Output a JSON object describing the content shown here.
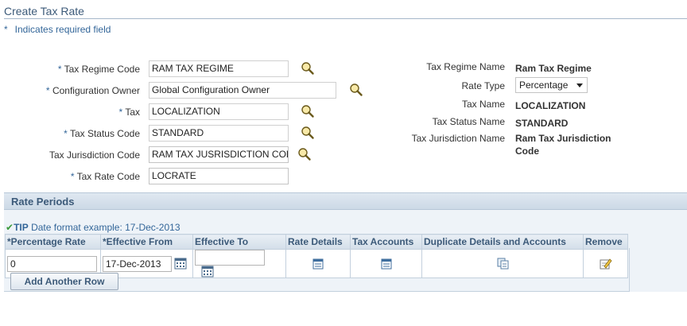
{
  "page": {
    "title": "Create Tax Rate",
    "required_note_star": "*",
    "required_note": "Indicates required field"
  },
  "form": {
    "tax_regime_code": {
      "label_req": "* ",
      "label": "Tax Regime Code",
      "value": "RAM TAX REGIME"
    },
    "configuration_owner": {
      "label_req": "* ",
      "label": "Configuration Owner",
      "value": "Global Configuration Owner"
    },
    "tax": {
      "label_req": "* ",
      "label": "Tax",
      "value": "LOCALIZATION"
    },
    "tax_status_code": {
      "label_req": "* ",
      "label": "Tax Status Code",
      "value": "STANDARD"
    },
    "tax_jurisdiction_code": {
      "label": "Tax Jurisdiction Code",
      "value": "RAM TAX JUSRISDICTION COD"
    },
    "tax_rate_code": {
      "label_req": "* ",
      "label": "Tax Rate Code",
      "value": "LOCRATE"
    }
  },
  "info": {
    "tax_regime_name": {
      "label": "Tax Regime Name",
      "value": "Ram Tax Regime"
    },
    "rate_type": {
      "label": "Rate Type",
      "value": "Percentage"
    },
    "tax_name": {
      "label": "Tax Name",
      "value": "LOCALIZATION"
    },
    "tax_status_name": {
      "label": "Tax Status Name",
      "value": "STANDARD"
    },
    "tax_jurisdiction_name": {
      "label": "Tax Jurisdiction Name",
      "value_line1": "Ram Tax Jurisdiction",
      "value_line2": "Code"
    }
  },
  "rate_periods": {
    "title": "Rate Periods",
    "tip_check": "✔",
    "tip_label": "TIP",
    "tip_text": "Date format example: 17-Dec-2013",
    "columns": {
      "percentage_rate": "*Percentage Rate",
      "effective_from": "*Effective From",
      "effective_to": "Effective To",
      "rate_details": "Rate Details",
      "tax_accounts": "Tax Accounts",
      "duplicate": "Duplicate Details and Accounts",
      "remove": "Remove"
    },
    "row": {
      "percentage_rate": "0",
      "effective_from": "17-Dec-2013",
      "effective_to": ""
    },
    "add_row_label": "Add Another Row"
  },
  "icons": {
    "search": "search-icon",
    "calendar": "calendar-icon",
    "details": "details-icon",
    "duplicate": "duplicate-icon",
    "remove": "remove-icon"
  },
  "colors": {
    "accent": "#336699",
    "header_text": "#3c5a79",
    "section_bg": "#eef3f8"
  }
}
